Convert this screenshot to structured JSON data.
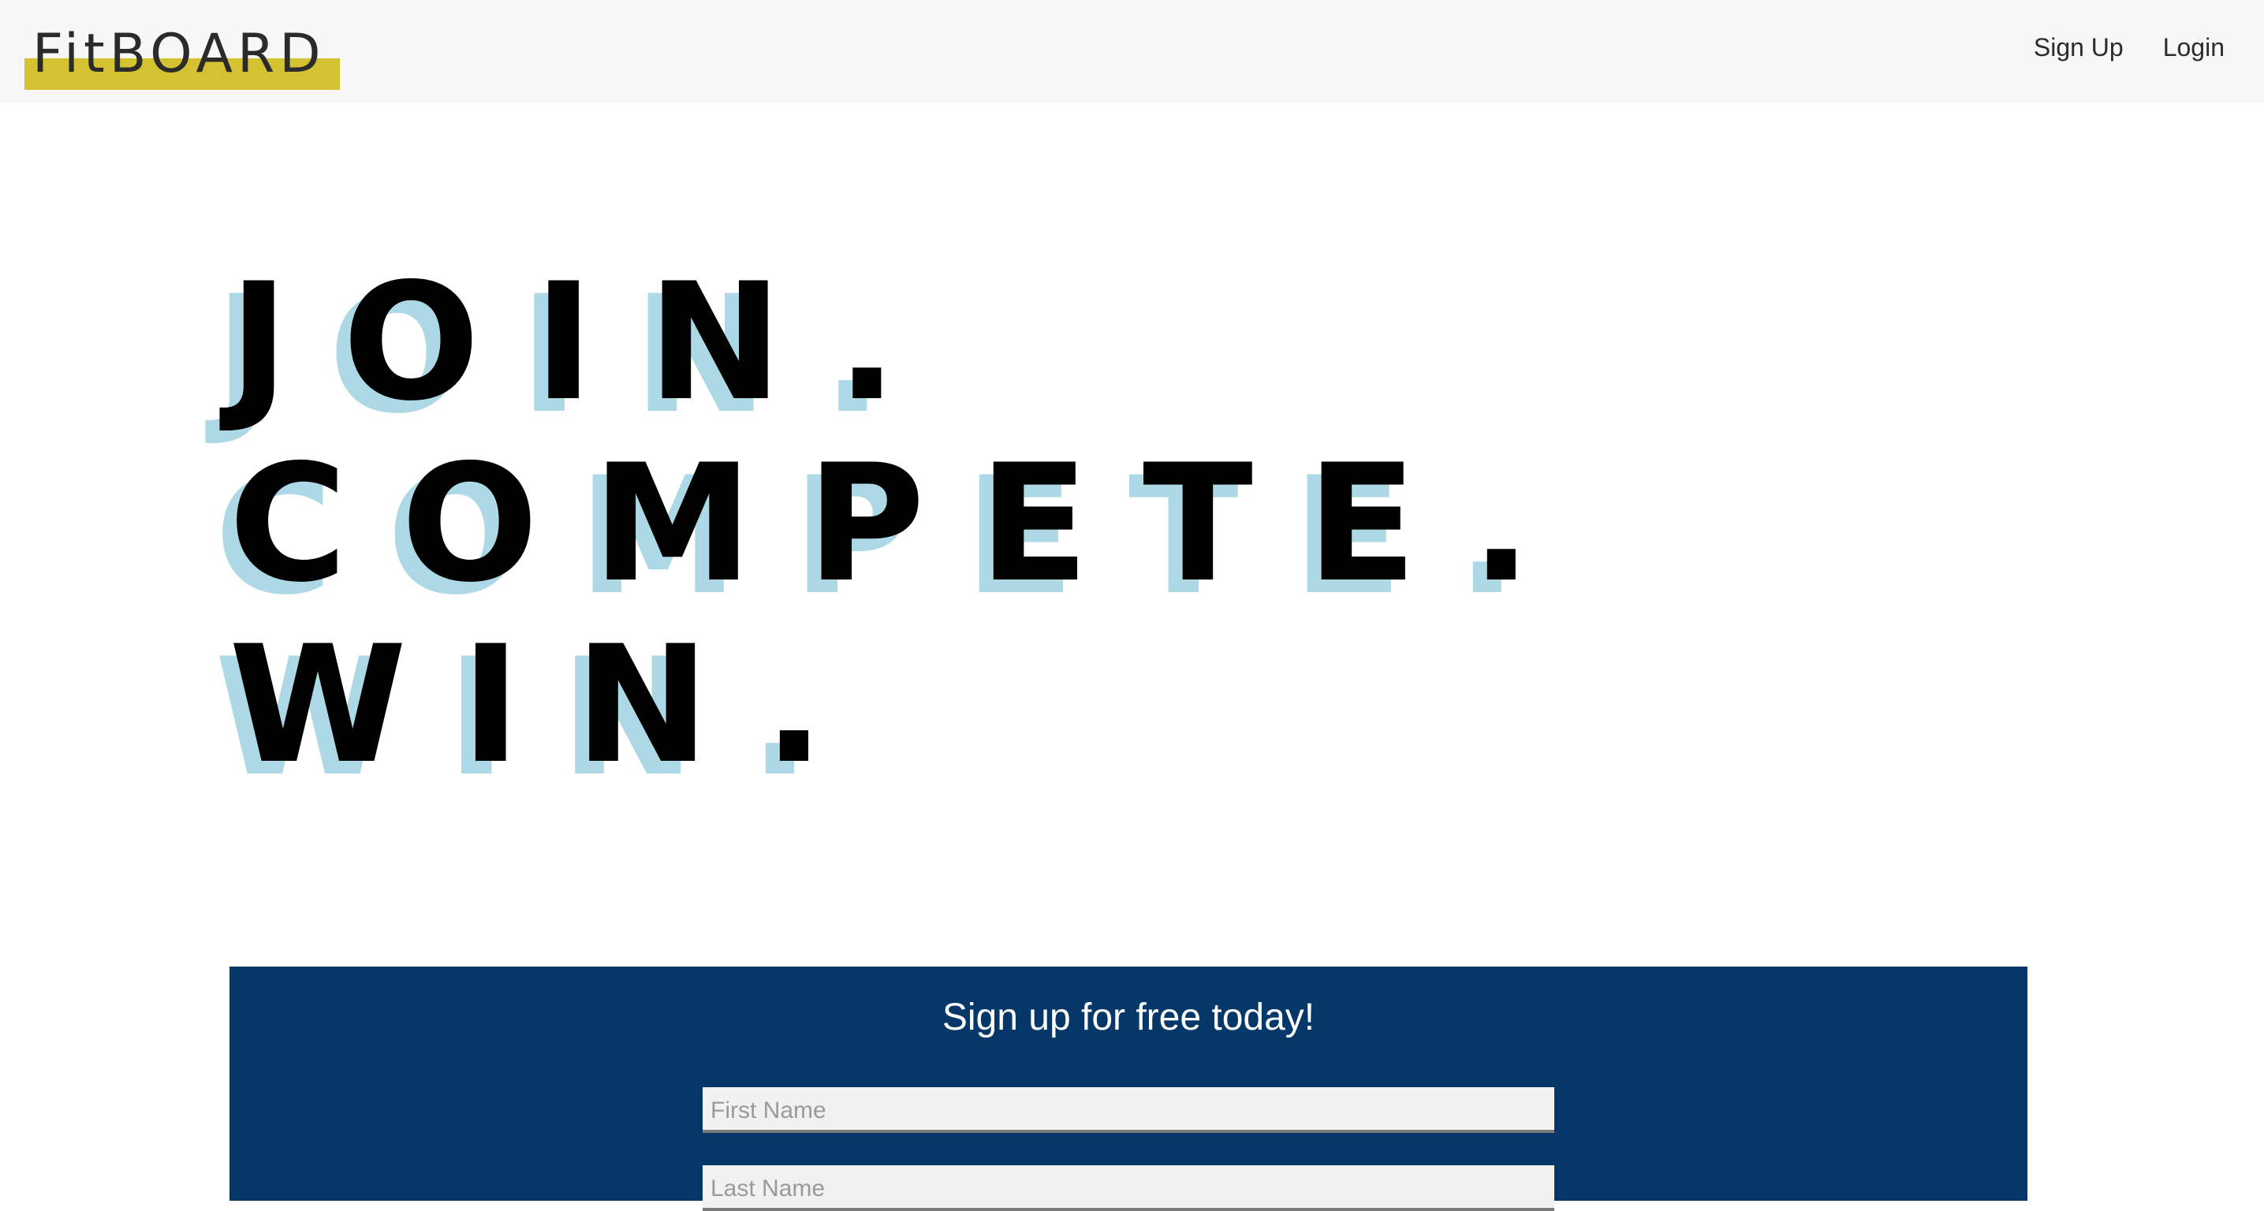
{
  "brand": {
    "name": "FitBOARD",
    "accent_color": "#d4c233"
  },
  "nav": {
    "signup_label": "Sign Up",
    "login_label": "Login"
  },
  "hero": {
    "line1": "JOIN.",
    "line2": "COMPETE.",
    "line3": "WIN.",
    "shadow_color": "#add8e6"
  },
  "signup": {
    "title": "Sign up for free today!",
    "first_name_placeholder": "First Name",
    "last_name_placeholder": "Last Name",
    "background_color": "#053769"
  }
}
